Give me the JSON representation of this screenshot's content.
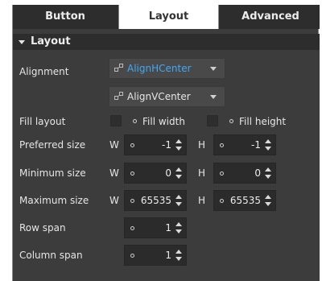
{
  "tabs": [
    {
      "label": "Button",
      "active": false
    },
    {
      "label": "Layout",
      "active": true
    },
    {
      "label": "Advanced",
      "active": false
    }
  ],
  "section": {
    "title": "Layout",
    "expanded": true
  },
  "alignment": {
    "label": "Alignment",
    "horizontal": {
      "value": "AlignHCenter",
      "color": "#3fa9f5",
      "icon": "alignment-icon"
    },
    "vertical": {
      "value": "AlignVCenter",
      "color": "#e6e6e6",
      "icon": "alignment-icon"
    }
  },
  "fill_layout": {
    "label": "Fill layout",
    "fill_width": {
      "label": "Fill width",
      "checked": false
    },
    "fill_height": {
      "label": "Fill height",
      "checked": false
    }
  },
  "w_label": "W",
  "h_label": "H",
  "preferred_size": {
    "label": "Preferred size",
    "w": "-1",
    "h": "-1"
  },
  "minimum_size": {
    "label": "Minimum size",
    "w": "0",
    "h": "0"
  },
  "maximum_size": {
    "label": "Maximum size",
    "w": "65535",
    "h": "65535"
  },
  "row_span": {
    "label": "Row span",
    "value": "1"
  },
  "column_span": {
    "label": "Column span",
    "value": "1"
  },
  "colors": {
    "panel_bg": "#3c3c3c",
    "header_bg": "#2d2d2d",
    "active_tab_bg": "#ffffff",
    "accent_blue": "#3fa9f5"
  }
}
